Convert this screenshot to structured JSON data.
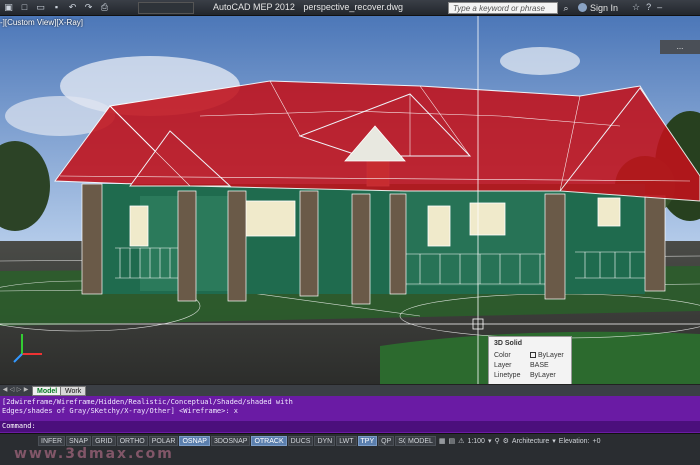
{
  "titlebar": {
    "app_title": "AutoCAD MEP 2012",
    "file_name": "perspective_recover.dwg",
    "search_placeholder": "Type a keyword or phrase",
    "signin_label": "Sign In",
    "qat_icons": [
      "app-menu-icon",
      "new-icon",
      "open-icon",
      "save-icon",
      "undo-icon",
      "redo-icon",
      "plot-icon"
    ]
  },
  "viewport": {
    "label": "-][Custom View][X-Ray]",
    "dashboard_label": "...",
    "colors": {
      "roof": "#c2121b",
      "wall": "#1d6a4d",
      "wireframe": "#ffffff",
      "sky": "#6f9ad4"
    },
    "tooltip": {
      "title": "3D Solid",
      "rows": [
        {
          "key": "Color",
          "value": "ByLayer"
        },
        {
          "key": "Layer",
          "value": "BASE"
        },
        {
          "key": "Linetype",
          "value": "ByLayer"
        }
      ]
    }
  },
  "tabs": {
    "items": [
      {
        "label": "Model",
        "active": true
      },
      {
        "label": "Work",
        "active": false
      }
    ]
  },
  "command": {
    "history_line1": "[2dwireframe/Wireframe/Hidden/Realistic/Conceptual/Shaded/shaded with",
    "history_line2": "Edges/shades of Gray/SKetchy/X-ray/Other] <Wireframe>: x",
    "prompt": "Command:"
  },
  "statusbar": {
    "toggles": [
      {
        "label": "INFER",
        "on": false
      },
      {
        "label": "SNAP",
        "on": false
      },
      {
        "label": "GRID",
        "on": false
      },
      {
        "label": "ORTHO",
        "on": false
      },
      {
        "label": "POLAR",
        "on": false
      },
      {
        "label": "OSNAP",
        "on": true
      },
      {
        "label": "3DOSNAP",
        "on": false
      },
      {
        "label": "OTRACK",
        "on": true
      },
      {
        "label": "DUCS",
        "on": false
      },
      {
        "label": "DYN",
        "on": false
      },
      {
        "label": "LWT",
        "on": false
      },
      {
        "label": "TPY",
        "on": true
      },
      {
        "label": "QP",
        "on": false
      },
      {
        "label": "SC",
        "on": false
      }
    ],
    "model_label": "MODEL",
    "scale_label": "1:100",
    "display_config": "Architecture",
    "elevation_label": "Elevation:",
    "elevation_value": "+0",
    "watermark": "www.3dmax.com"
  }
}
